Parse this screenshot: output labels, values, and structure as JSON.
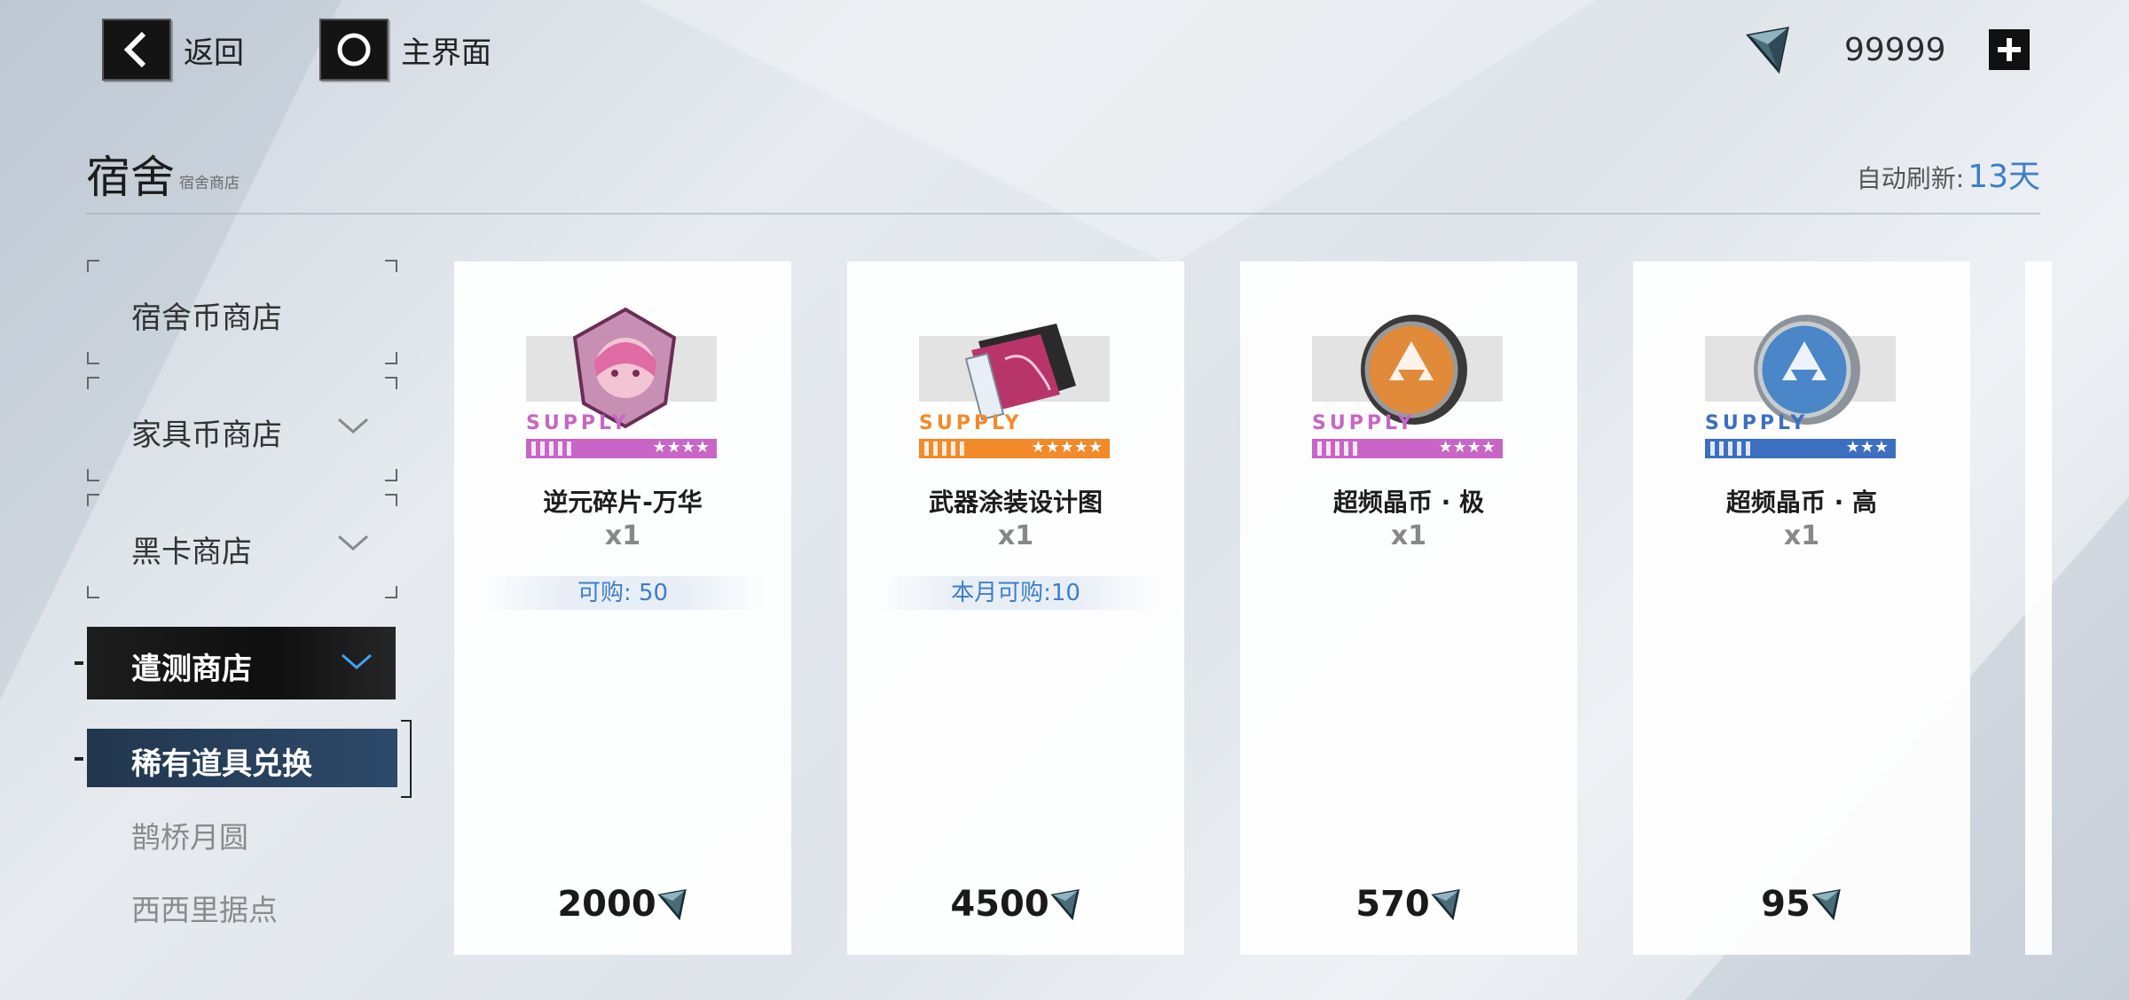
{
  "topbar": {
    "back_label": "返回",
    "home_label": "主界面",
    "currency_value": "99999",
    "currency_icon": "prism-currency-icon",
    "add_icon": "plus-icon"
  },
  "header": {
    "title": "宿舍",
    "subtitle": "宿舍商店",
    "refresh_label": "自动刷新:",
    "refresh_value": "13天"
  },
  "sidebar": {
    "items": [
      {
        "label": "宿舍币商店"
      },
      {
        "label": "家具币商店"
      },
      {
        "label": "黑卡商店"
      }
    ],
    "active": {
      "label": "遣测商店"
    },
    "active_sub": {
      "label": "稀有道具兑换"
    },
    "sub_items": [
      {
        "label": "鹊桥月圆"
      },
      {
        "label": "西西里据点"
      }
    ]
  },
  "cards": [
    {
      "name": "逆元碎片-万华",
      "qty": "x1",
      "limit": "可购: 50",
      "price": "2000",
      "supply": "SUPPLY",
      "stars": "★★★★",
      "rarity_color": "#c865c6"
    },
    {
      "name": "武器涂装设计图",
      "qty": "x1",
      "limit": "本月可购:10",
      "price": "4500",
      "supply": "SUPPLY",
      "stars": "★★★★★",
      "rarity_color": "#f28a2a"
    },
    {
      "name": "超频晶币 · 极",
      "qty": "x1",
      "limit": "",
      "price": "570",
      "supply": "SUPPLY",
      "stars": "★★★★",
      "rarity_color": "#c865c6"
    },
    {
      "name": "超频晶币 · 高",
      "qty": "x1",
      "limit": "",
      "price": "95",
      "supply": "SUPPLY",
      "stars": "★★★",
      "rarity_color": "#3d6fc0"
    }
  ]
}
